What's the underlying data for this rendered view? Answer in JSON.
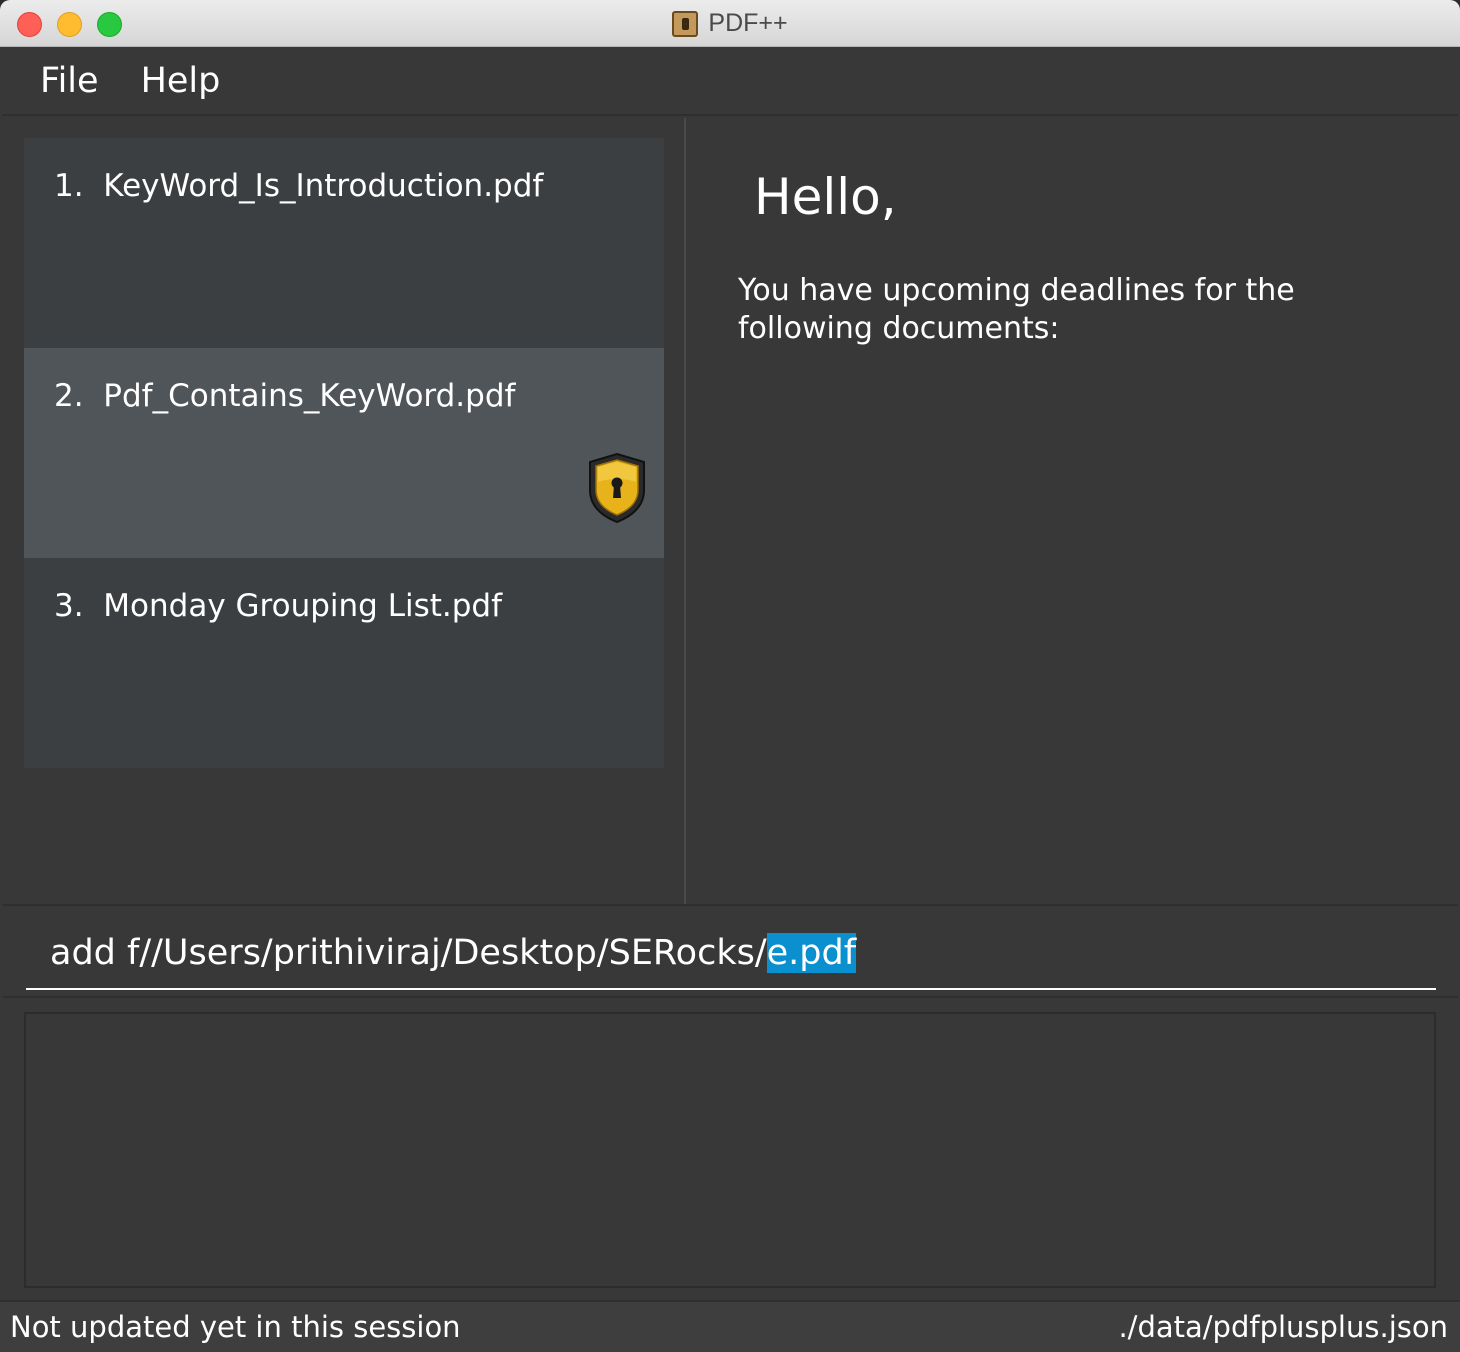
{
  "window": {
    "title": "PDF++"
  },
  "menu": {
    "items": [
      "File",
      "Help"
    ]
  },
  "documents": [
    {
      "index": "1.",
      "name": "KeyWord_Is_Introduction.pdf",
      "locked": false,
      "selected": false
    },
    {
      "index": "2.",
      "name": "Pdf_Contains_KeyWord.pdf",
      "locked": true,
      "selected": true,
      "lock_icon": "keyhole-shield-icon"
    },
    {
      "index": "3.",
      "name": "Monday Grouping List.pdf",
      "locked": false,
      "selected": false
    }
  ],
  "panel": {
    "greeting": "Hello,",
    "message": "You have upcoming deadlines for the following documents:"
  },
  "command": {
    "value_prefix": "add f//Users/prithiviraj/Desktop/SERocks/",
    "value_selected": "e.pdf"
  },
  "result": {
    "text": ""
  },
  "status": {
    "left": "Not updated yet in this session",
    "right": "./data/pdfplusplus.json"
  },
  "colors": {
    "background": "#383838",
    "card": "#3c3f41",
    "card_selected": "#50555a",
    "selection": "#0a8fcf",
    "lock_gold": "#e8b21a"
  }
}
